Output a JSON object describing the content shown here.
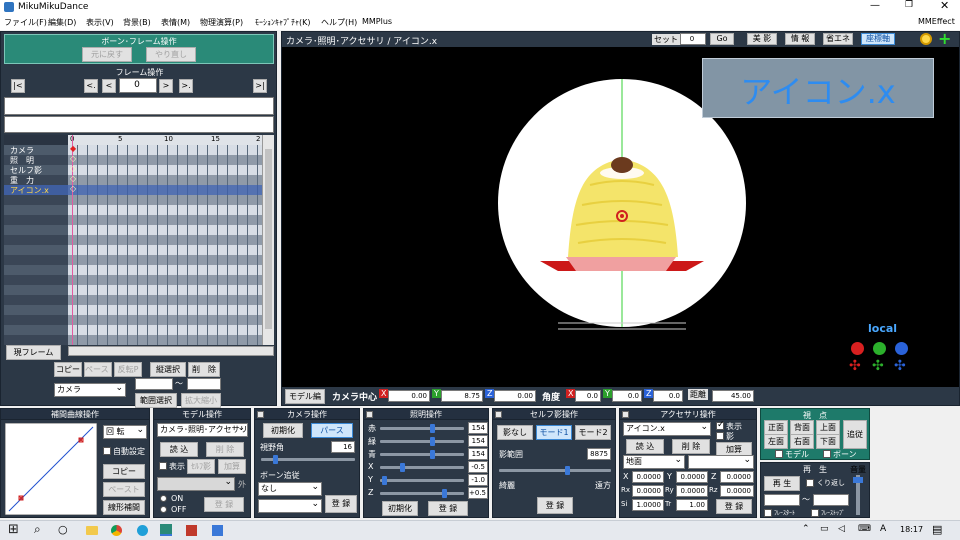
{
  "window": {
    "title": "MikuMikuDance"
  },
  "menu": [
    "ファイル(F)",
    "編集(D)",
    "表示(V)",
    "背景(B)",
    "表情(M)",
    "物理演算(P)",
    "ﾓｰｼｮﾝｷｬﾌﾟﾁｬ(K)",
    "ヘルプ(H)",
    "MMPlus"
  ],
  "menu_right": "MMEffect",
  "bone_panel": {
    "title": "ボーン･フレーム操作",
    "undo": "元に戻す",
    "redo": "やり直し"
  },
  "frame_panel": {
    "title": "フレーム操作",
    "first": "|<",
    "prev_key": "<.",
    "prev": "<",
    "frame_value": "0",
    "next": ">",
    "next_key": ">.",
    "last": ">|"
  },
  "timeline": {
    "ruler": [
      "0",
      "5",
      "10",
      "15",
      "2"
    ],
    "tracks": [
      "カメラ",
      "照　明",
      "セルフ影",
      "重　力",
      "アイコン.x"
    ]
  },
  "left_bottom": {
    "current_frame": "現フレーム",
    "copy": "コピー",
    "paste": "ペースト",
    "reverse": "反転P",
    "vertical_select": "縦選択",
    "delete": "削　除",
    "camera_select": "カメラ",
    "range_select": "範囲選択",
    "zoom": "拡大縮小",
    "tilde": "～"
  },
  "viewport": {
    "title": "カメラ･照明･アクセサリ / アイコン.x",
    "set_label": "セット",
    "set_value": "0",
    "go": "Go",
    "shadow": "美 影",
    "info": "情 報",
    "eco": "省エネ",
    "axis": "座標軸",
    "overlay_text": "アイコン.x",
    "local_label": "local",
    "model_edit": "モデル編",
    "camera_center": "カメラ中心",
    "center_x": "0.00",
    "center_y": "8.75",
    "center_z": "0.00",
    "angle_label": "角度",
    "angle_x": "0.0",
    "angle_y": "0.0",
    "angle_z": "0.0",
    "distance_label": "距離",
    "distance": "45.00",
    "axis_x": "X",
    "axis_y": "Y",
    "axis_z": "Z"
  },
  "curve_panel": {
    "title": "補間曲線操作",
    "rotate": "回 転",
    "auto": "自動設定",
    "copy": "コピー",
    "paste": "ペースト",
    "linear": "線形補間"
  },
  "model_panel": {
    "title": "モデル操作",
    "model_select": "カメラ･照明･アクセサリ",
    "load": "読 込",
    "delete": "削 除",
    "show": "表示",
    "self_shadow": "ｾﾙﾌ影",
    "add": "加算",
    "outside": "外",
    "on": "ON",
    "off": "OFF",
    "register": "登 録"
  },
  "camera_panel": {
    "title": "カメラ操作",
    "reset": "初期化",
    "perspective": "パース",
    "fov_label": "視野角",
    "fov_value": "16",
    "bone_follow": "ボーン追従",
    "follow_value": "なし",
    "register": "登 録"
  },
  "light_panel": {
    "title": "照明操作",
    "r_label": "赤",
    "g_label": "緑",
    "b_label": "青",
    "r": "154",
    "g": "154",
    "b": "154",
    "x_label": "X",
    "y_label": "Y",
    "z_label": "Z",
    "x": "-0.5",
    "y": "-1.0",
    "z": "+0.5",
    "reset": "初期化",
    "register": "登 録"
  },
  "shadow_panel": {
    "title": "セルフ影操作",
    "none": "影なし",
    "mode1": "モード1",
    "mode2": "モード2",
    "range_label": "影範囲",
    "range_value": "8875",
    "near": "綺麗",
    "far": "遠方",
    "register": "登 録"
  },
  "accessory_panel": {
    "title": "アクセサリ操作",
    "select": "アイコン.x",
    "show": "表示",
    "shadow": "影",
    "load": "読 込",
    "delete": "削 除",
    "add": "加算",
    "attach": "地面",
    "x": "0.0000",
    "y": "0.0000",
    "z": "0.0000",
    "rx": "0.0000",
    "ry": "0.0000",
    "rz": "0.0000",
    "si": "1.0000",
    "tr": "1.00",
    "l_x": "X",
    "l_y": "Y",
    "l_z": "Z",
    "l_rx": "Rx",
    "l_ry": "Ry",
    "l_rz": "Rz",
    "l_si": "Si",
    "l_tr": "Tr",
    "register": "登 録"
  },
  "view_panel": {
    "title": "視　点",
    "front": "正面",
    "back": "背面",
    "top": "上面",
    "left": "左面",
    "right": "右面",
    "bottom": "下面",
    "follow": "追従",
    "model": "モデル",
    "bone": "ボーン"
  },
  "play_panel": {
    "title": "再　生",
    "play": "再 生",
    "repeat": "くり返し",
    "volume": "音量",
    "frame_start": "ﾌﾚｰｽﾀｰﾄ",
    "frame_stop": "ﾌﾚｰｽﾄｯﾌﾟ",
    "tilde": "～"
  },
  "taskbar": {
    "time": "18:17"
  },
  "colors": {
    "accent_green": "#2a8a78",
    "viewport_bg": "#000000",
    "panel_bg": "#2c3846",
    "cream": "#f4e46a"
  }
}
